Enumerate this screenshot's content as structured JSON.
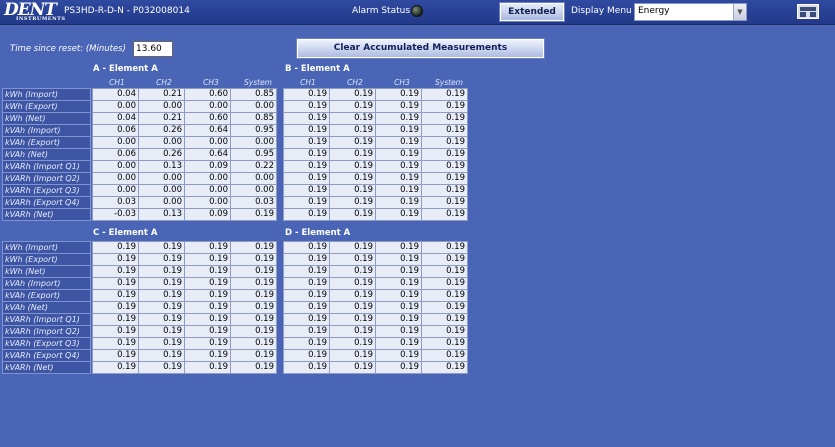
{
  "header": {
    "logo_main": "DENT",
    "logo_sub": "INSTRUMENTS",
    "device_id": "PS3HD-R-D-N - P032008014",
    "alarm_label": "Alarm Status",
    "extended_button": "Extended",
    "display_menu_label": "Display Menu",
    "display_menu_value": "Energy"
  },
  "controls": {
    "time_since_reset_label": "Time since reset: (Minutes)",
    "time_since_reset_value": "13.60",
    "clear_button": "Clear Accumulated Measurements"
  },
  "columns": [
    "CH1",
    "CH2",
    "CH3",
    "System"
  ],
  "row_labels": [
    "kWh (Import)",
    "kWh (Export)",
    "kWh (Net)",
    "kVAh (Import)",
    "kVAh (Export)",
    "kVAh (Net)",
    "kVARh (Import Q1)",
    "kVARh (Import Q2)",
    "kVARh (Export Q3)",
    "kVARh (Export Q4)",
    "kVARh (Net)"
  ],
  "sections": {
    "A": {
      "title": "A - Element A",
      "rows": [
        [
          "0.04",
          "0.21",
          "0.60",
          "0.85"
        ],
        [
          "0.00",
          "0.00",
          "0.00",
          "0.00"
        ],
        [
          "0.04",
          "0.21",
          "0.60",
          "0.85"
        ],
        [
          "0.06",
          "0.26",
          "0.64",
          "0.95"
        ],
        [
          "0.00",
          "0.00",
          "0.00",
          "0.00"
        ],
        [
          "0.06",
          "0.26",
          "0.64",
          "0.95"
        ],
        [
          "0.00",
          "0.13",
          "0.09",
          "0.22"
        ],
        [
          "0.00",
          "0.00",
          "0.00",
          "0.00"
        ],
        [
          "0.00",
          "0.00",
          "0.00",
          "0.00"
        ],
        [
          "0.03",
          "0.00",
          "0.00",
          "0.03"
        ],
        [
          "-0.03",
          "0.13",
          "0.09",
          "0.19"
        ]
      ]
    },
    "B": {
      "title": "B - Element A",
      "rows": [
        [
          "0.19",
          "0.19",
          "0.19",
          "0.19"
        ],
        [
          "0.19",
          "0.19",
          "0.19",
          "0.19"
        ],
        [
          "0.19",
          "0.19",
          "0.19",
          "0.19"
        ],
        [
          "0.19",
          "0.19",
          "0.19",
          "0.19"
        ],
        [
          "0.19",
          "0.19",
          "0.19",
          "0.19"
        ],
        [
          "0.19",
          "0.19",
          "0.19",
          "0.19"
        ],
        [
          "0.19",
          "0.19",
          "0.19",
          "0.19"
        ],
        [
          "0.19",
          "0.19",
          "0.19",
          "0.19"
        ],
        [
          "0.19",
          "0.19",
          "0.19",
          "0.19"
        ],
        [
          "0.19",
          "0.19",
          "0.19",
          "0.19"
        ],
        [
          "0.19",
          "0.19",
          "0.19",
          "0.19"
        ]
      ]
    },
    "C": {
      "title": "C - Element A",
      "rows": [
        [
          "0.19",
          "0.19",
          "0.19",
          "0.19"
        ],
        [
          "0.19",
          "0.19",
          "0.19",
          "0.19"
        ],
        [
          "0.19",
          "0.19",
          "0.19",
          "0.19"
        ],
        [
          "0.19",
          "0.19",
          "0.19",
          "0.19"
        ],
        [
          "0.19",
          "0.19",
          "0.19",
          "0.19"
        ],
        [
          "0.19",
          "0.19",
          "0.19",
          "0.19"
        ],
        [
          "0.19",
          "0.19",
          "0.19",
          "0.19"
        ],
        [
          "0.19",
          "0.19",
          "0.19",
          "0.19"
        ],
        [
          "0.19",
          "0.19",
          "0.19",
          "0.19"
        ],
        [
          "0.19",
          "0.19",
          "0.19",
          "0.19"
        ],
        [
          "0.19",
          "0.19",
          "0.19",
          "0.19"
        ]
      ]
    },
    "D": {
      "title": "D - Element A",
      "rows": [
        [
          "0.19",
          "0.19",
          "0.19",
          "0.19"
        ],
        [
          "0.19",
          "0.19",
          "0.19",
          "0.19"
        ],
        [
          "0.19",
          "0.19",
          "0.19",
          "0.19"
        ],
        [
          "0.19",
          "0.19",
          "0.19",
          "0.19"
        ],
        [
          "0.19",
          "0.19",
          "0.19",
          "0.19"
        ],
        [
          "0.19",
          "0.19",
          "0.19",
          "0.19"
        ],
        [
          "0.19",
          "0.19",
          "0.19",
          "0.19"
        ],
        [
          "0.19",
          "0.19",
          "0.19",
          "0.19"
        ],
        [
          "0.19",
          "0.19",
          "0.19",
          "0.19"
        ],
        [
          "0.19",
          "0.19",
          "0.19",
          "0.19"
        ],
        [
          "0.19",
          "0.19",
          "0.19",
          "0.19"
        ]
      ]
    }
  },
  "icons": {
    "alarm": "alarm-led-icon",
    "select_arrow": "chevron-down-icon",
    "toolbar": "keyboard-icon"
  },
  "colors": {
    "background": "#4a65b5",
    "header": "#23398a",
    "cell": "#e8ecf6",
    "label_cell": "#3e55a3"
  }
}
